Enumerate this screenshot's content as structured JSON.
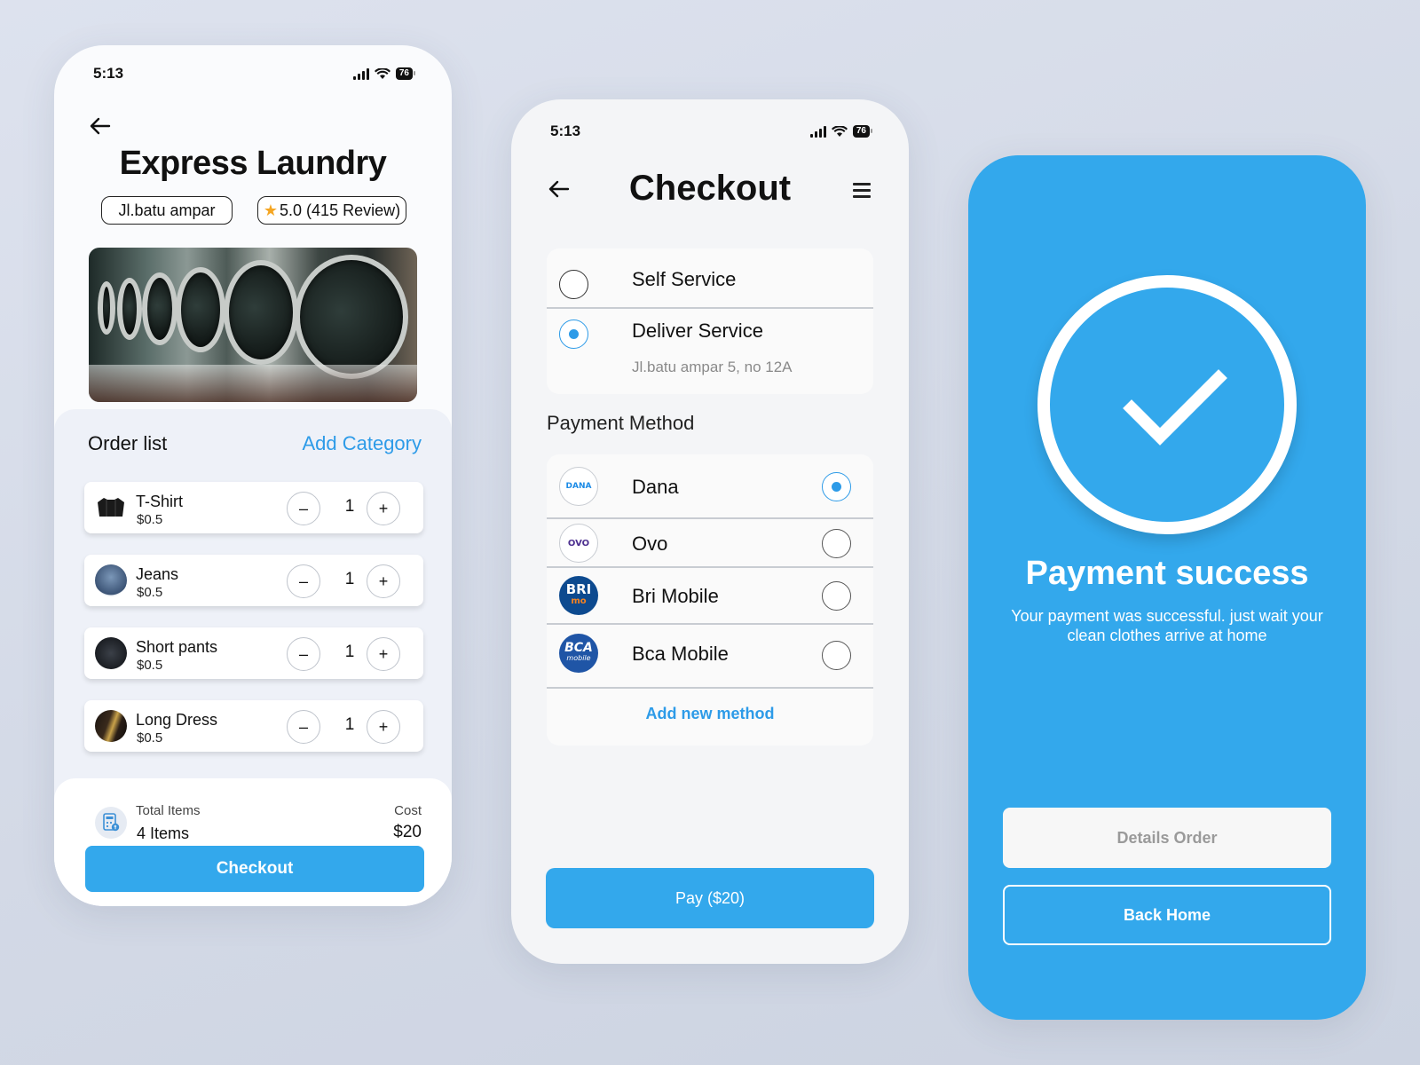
{
  "colors": {
    "accent": "#33a8ec",
    "link": "#2d9be8",
    "star": "#f5a623"
  },
  "laundry_screen": {
    "status_time": "5:13",
    "battery": "76",
    "title": "Express Laundry",
    "location": "Jl.batu ampar",
    "rating": "5.0 (415 Review)",
    "order_list_label": "Order list",
    "add_category_label": "Add Category",
    "items": [
      {
        "name": "T-Shirt",
        "price": "$0.5",
        "qty": "1",
        "minus": "–",
        "plus": "+"
      },
      {
        "name": "Jeans",
        "price": "$0.5",
        "qty": "1",
        "minus": "–",
        "plus": "+"
      },
      {
        "name": "Short pants",
        "price": "$0.5",
        "qty": "1",
        "minus": "–",
        "plus": "+"
      },
      {
        "name": "Long Dress",
        "price": "$0.5",
        "qty": "1",
        "minus": "–",
        "plus": "+"
      }
    ],
    "total_items_label": "Total Items",
    "total_items_value": "4 Items",
    "cost_label": "Cost",
    "cost_value": "$20",
    "checkout_label": "Checkout"
  },
  "checkout_screen": {
    "status_time": "5:13",
    "battery": "76",
    "title": "Checkout",
    "service_options": [
      {
        "label": "Self Service",
        "selected": false
      },
      {
        "label": "Deliver Service",
        "selected": true,
        "address": "Jl.batu ampar 5, no 12A"
      }
    ],
    "payment_method_label": "Payment Method",
    "payment_methods": [
      {
        "label": "Dana",
        "logo_text": "DANA",
        "selected": true
      },
      {
        "label": "Ovo",
        "logo_text": "OVO",
        "selected": false
      },
      {
        "label": "Bri Mobile",
        "logo_text": "BRI",
        "logo_sub": "mo",
        "selected": false
      },
      {
        "label": "Bca Mobile",
        "logo_text": "BCA",
        "logo_sub": "mobile",
        "selected": false
      }
    ],
    "add_method_label": "Add new method",
    "pay_label": "Pay ($20)"
  },
  "success_screen": {
    "title": "Payment success",
    "message": "Your payment was successful. just wait your clean clothes arrive at home",
    "details_label": "Details Order",
    "back_home_label": "Back Home"
  }
}
